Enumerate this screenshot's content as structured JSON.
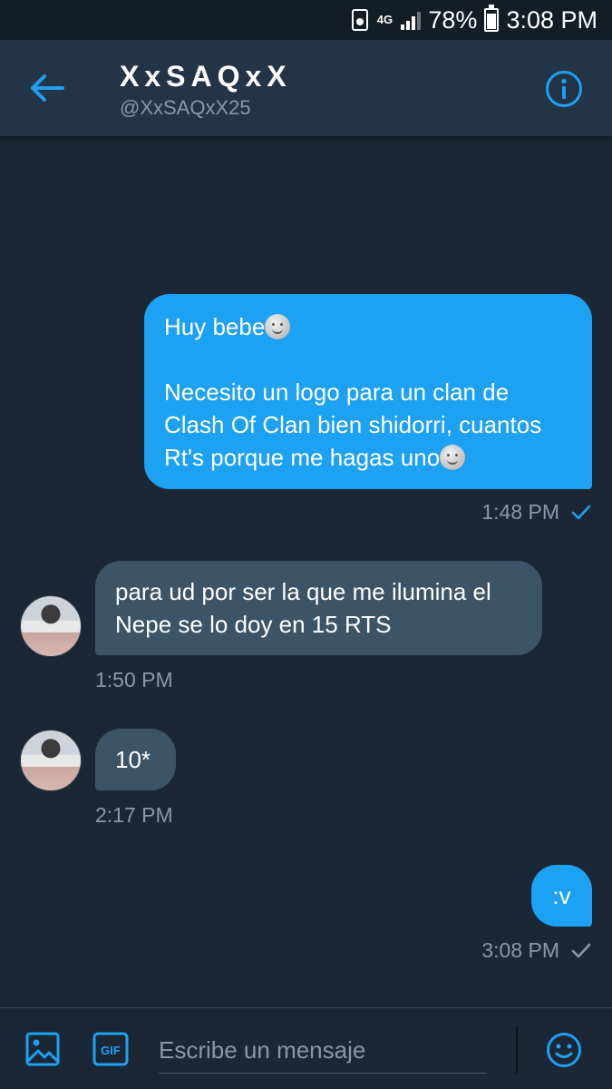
{
  "status_bar": {
    "network": "4G",
    "battery_percent": "78%",
    "time": "3:08 PM",
    "icons": [
      "battery-saver-icon",
      "signal-icon",
      "battery-icon"
    ]
  },
  "header": {
    "name": "XxSAQxX",
    "handle": "@XxSAQxX25",
    "back_icon": "arrow-left-icon",
    "info_icon": "info-icon"
  },
  "messages": [
    {
      "direction": "sent",
      "paragraphs": [
        "Huy bebe",
        "Necesito un logo para un clan de Clash Of Clan bien shidorri, cuantos Rt's porque me hagas uno"
      ],
      "emoji": "moon-face-emoji",
      "time": "1:48 PM",
      "status": "read"
    },
    {
      "direction": "received",
      "text": "para ud por ser la que me ilumina el Nepe se lo doy en 15 RTS",
      "time": "1:50 PM"
    },
    {
      "direction": "received",
      "text": "10*",
      "time": "2:17 PM"
    },
    {
      "direction": "sent",
      "text": ":v",
      "time": "3:08 PM",
      "status": "sent"
    }
  ],
  "compose": {
    "placeholder": "Escribe un mensaje",
    "gif_label": "GIF",
    "icons": [
      "image-icon",
      "gif-icon",
      "emoji-icon"
    ]
  },
  "colors": {
    "background": "#1b2734",
    "header": "#243447",
    "accent": "#1da1f2",
    "received_bubble": "#3d5466",
    "secondary_text": "#8899a6"
  }
}
